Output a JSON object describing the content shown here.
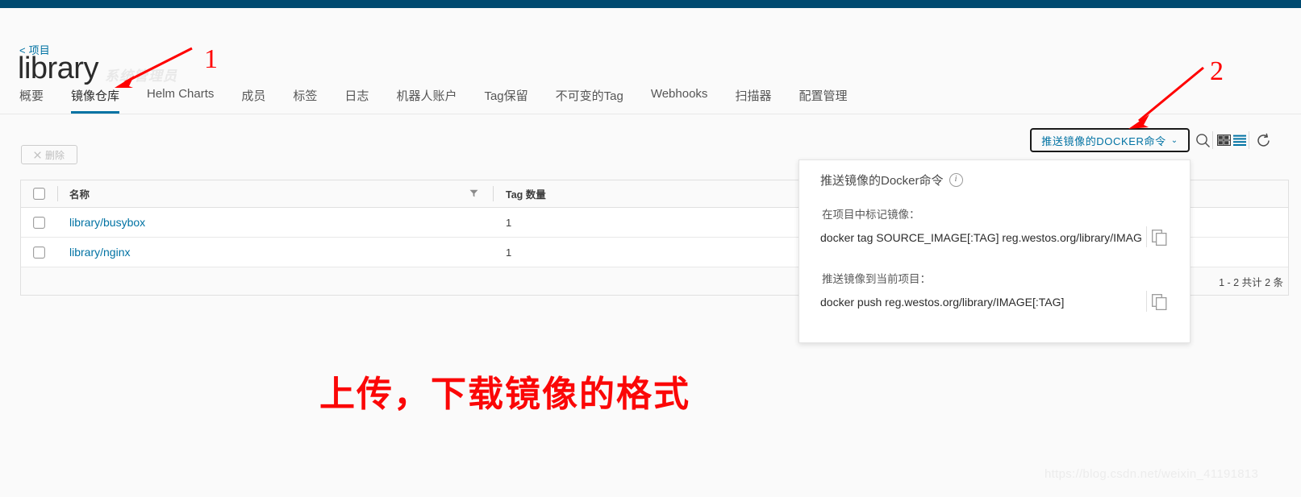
{
  "app": {
    "topbar_color": "#004a70",
    "accent_color": "#0072a3",
    "annotation_color": "#ff0000"
  },
  "header": {
    "breadcrumb": "< 项目",
    "title": "library",
    "watermark": "系统管理员"
  },
  "tabs": [
    {
      "label": "概要",
      "active": false
    },
    {
      "label": "镜像仓库",
      "active": true
    },
    {
      "label": "Helm Charts",
      "active": false
    },
    {
      "label": "成员",
      "active": false
    },
    {
      "label": "标签",
      "active": false
    },
    {
      "label": "日志",
      "active": false
    },
    {
      "label": "机器人账户",
      "active": false
    },
    {
      "label": "Tag保留",
      "active": false
    },
    {
      "label": "不可变的Tag",
      "active": false
    },
    {
      "label": "Webhooks",
      "active": false
    },
    {
      "label": "扫描器",
      "active": false
    },
    {
      "label": "配置管理",
      "active": false
    }
  ],
  "toolbar": {
    "docker_button_label": "推送镜像的DOCKER命令",
    "docker_button_caret": "⌄",
    "search_icon": "search-icon",
    "card_view_icon": "grid-view-icon",
    "list_view_icon": "list-view-icon",
    "refresh_icon": "refresh-icon"
  },
  "actions": {
    "delete_label": "删除",
    "delete_icon": "close-x-icon"
  },
  "table": {
    "columns": [
      "名称",
      "Tag 数量"
    ],
    "rows": [
      {
        "name": "library/busybox",
        "tag_count": "1"
      },
      {
        "name": "library/nginx",
        "tag_count": "1"
      }
    ],
    "pagination": "1 - 2 共计 2 条"
  },
  "docker_panel": {
    "title": "推送镜像的Docker命令",
    "info_glyph": "i",
    "section1_label": "在项目中标记镜像：",
    "section1_command": "docker tag SOURCE_IMAGE[:TAG] reg.westos.org/library/IMAGE[:TAG]",
    "section2_label": "推送镜像到当前项目：",
    "section2_command": "docker push reg.westos.org/library/IMAGE[:TAG]",
    "copy_icon": "copy-icon"
  },
  "annotations": {
    "marker_1": "1",
    "marker_2": "2",
    "caption": "上传，下载镜像的格式",
    "blog_watermark": "https://blog.csdn.net/weixin_41191813"
  }
}
